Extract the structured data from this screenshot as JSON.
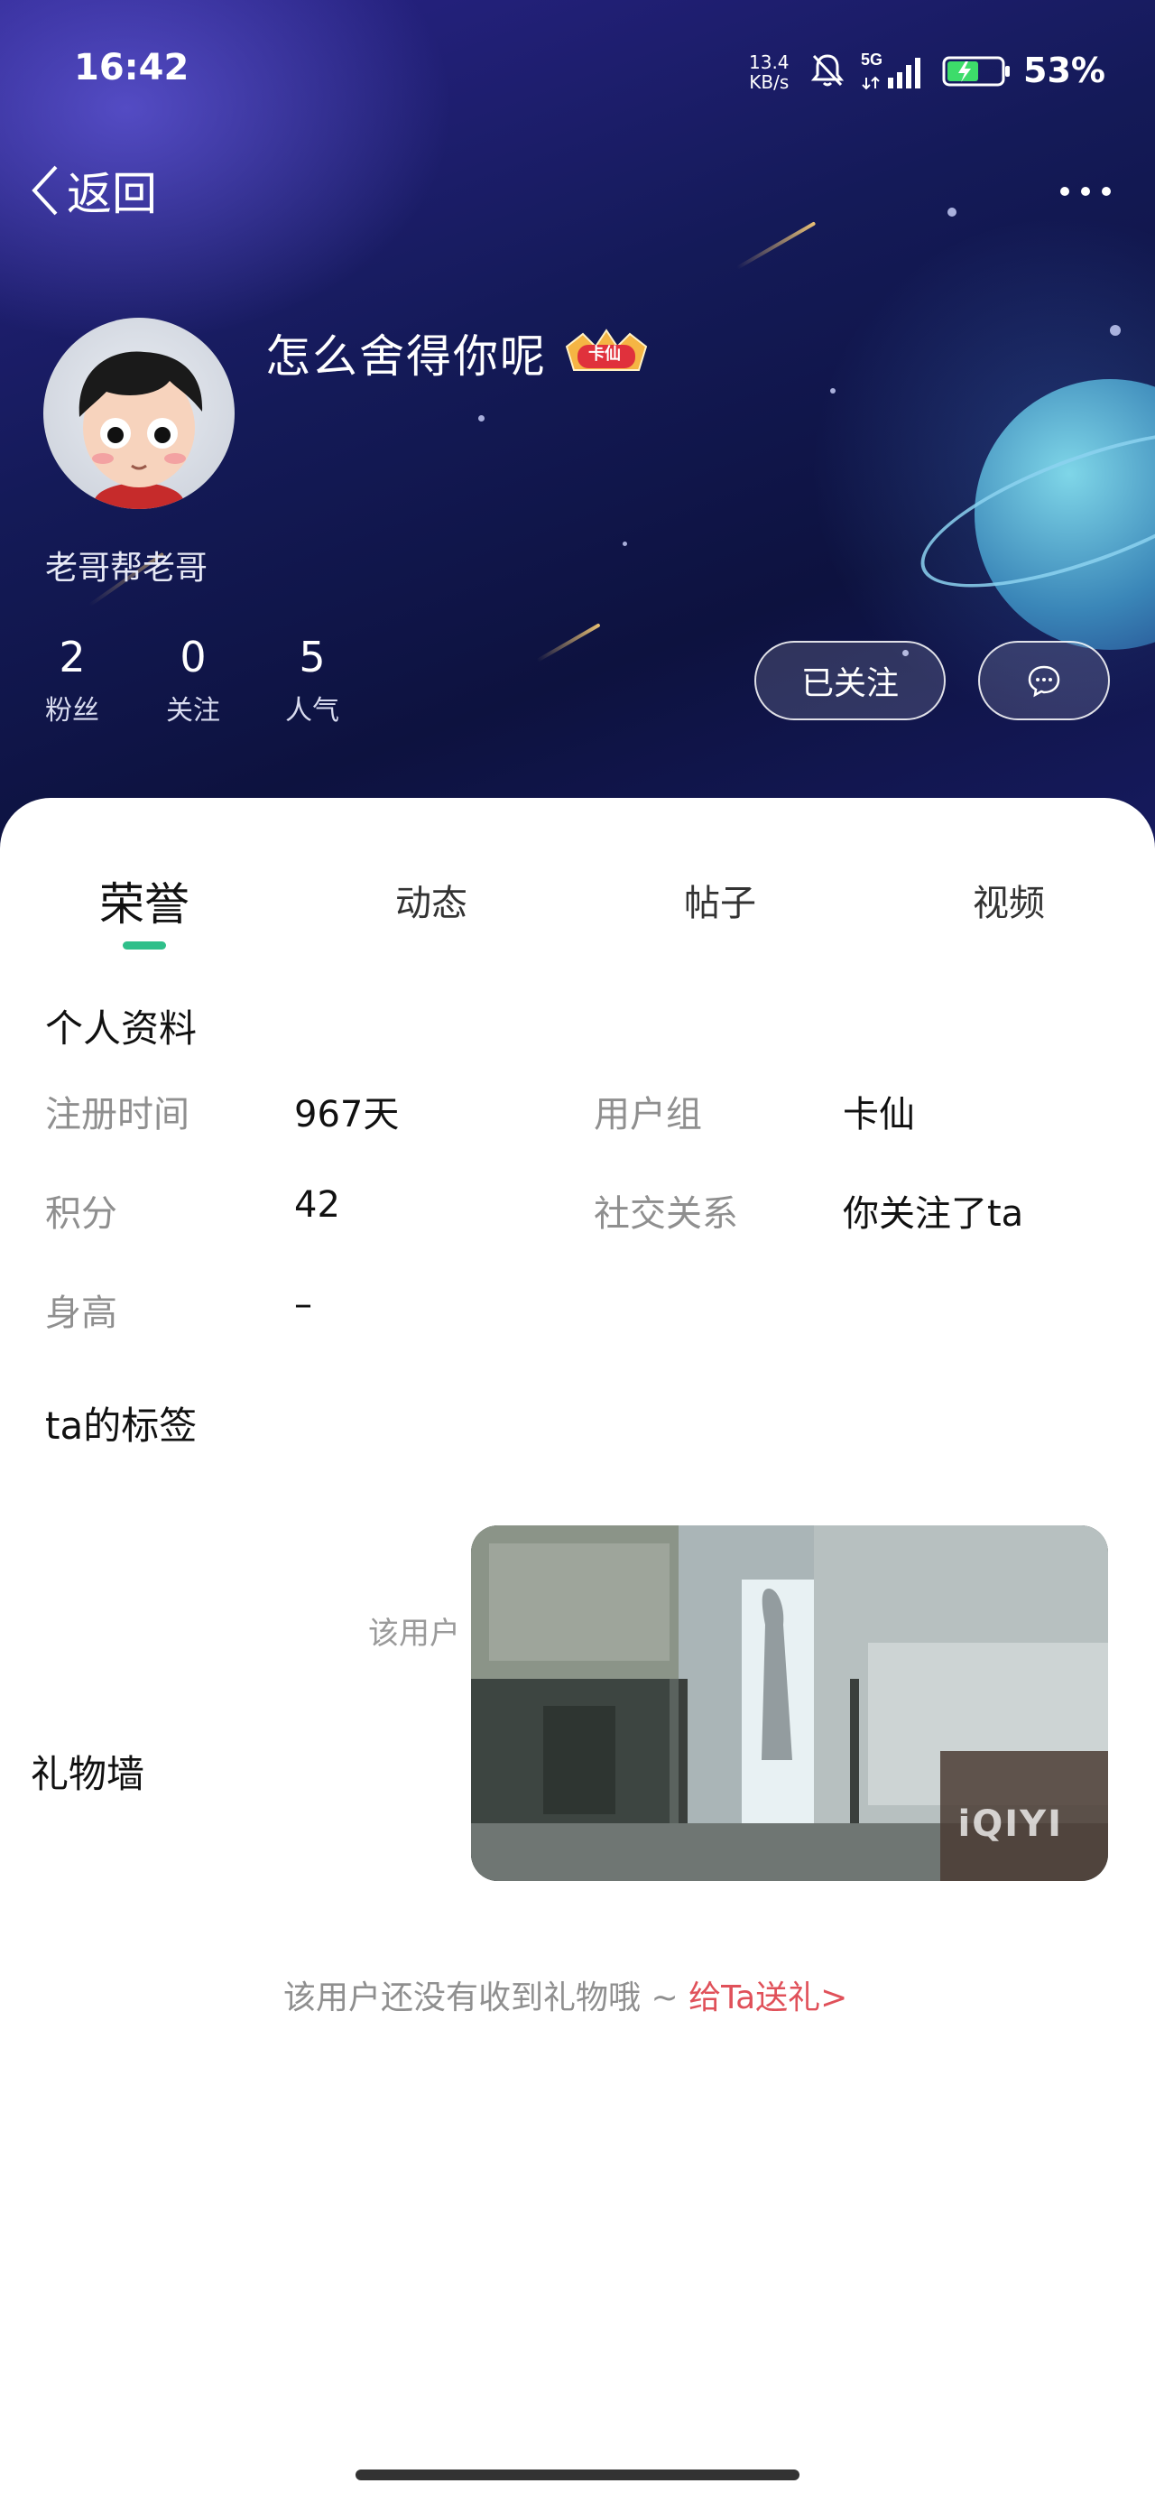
{
  "status_bar": {
    "time": "16:42",
    "net_speed_value": "13.4",
    "net_speed_unit": "KB/s",
    "signal_label": "5G",
    "battery": "53%"
  },
  "nav": {
    "back_label": "返回"
  },
  "profile": {
    "username": "怎么舍得你呢",
    "badge_text": "卡仙",
    "signature": "老哥帮老哥",
    "stats": [
      {
        "value": "2",
        "label": "粉丝"
      },
      {
        "value": "0",
        "label": "关注"
      },
      {
        "value": "5",
        "label": "人气"
      }
    ],
    "follow_label": "已关注"
  },
  "tabs": [
    {
      "label": "荣誉"
    },
    {
      "label": "动态"
    },
    {
      "label": "帖子"
    },
    {
      "label": "视频"
    }
  ],
  "personal_info": {
    "title": "个人资料",
    "rows": [
      {
        "label": "注册时间",
        "value": "967天"
      },
      {
        "label": "用户组",
        "value": "卡仙"
      },
      {
        "label": "积分",
        "value": "42"
      },
      {
        "label": "社交关系",
        "value": "你关注了ta"
      },
      {
        "label": "身高",
        "value": "–"
      }
    ]
  },
  "tags": {
    "title": "ta的标签",
    "empty_text": "该用户"
  },
  "video_overlay": {
    "watermark": "iQIYI"
  },
  "gifts": {
    "title": "礼物墙",
    "empty_text": "该用户还没有收到礼物哦 ~ ",
    "send_link": "给Ta送礼>"
  },
  "colors": {
    "accent_tab_underline": "#2fbf8a",
    "gift_link": "#e0515a",
    "header_bg": "#141a58"
  }
}
